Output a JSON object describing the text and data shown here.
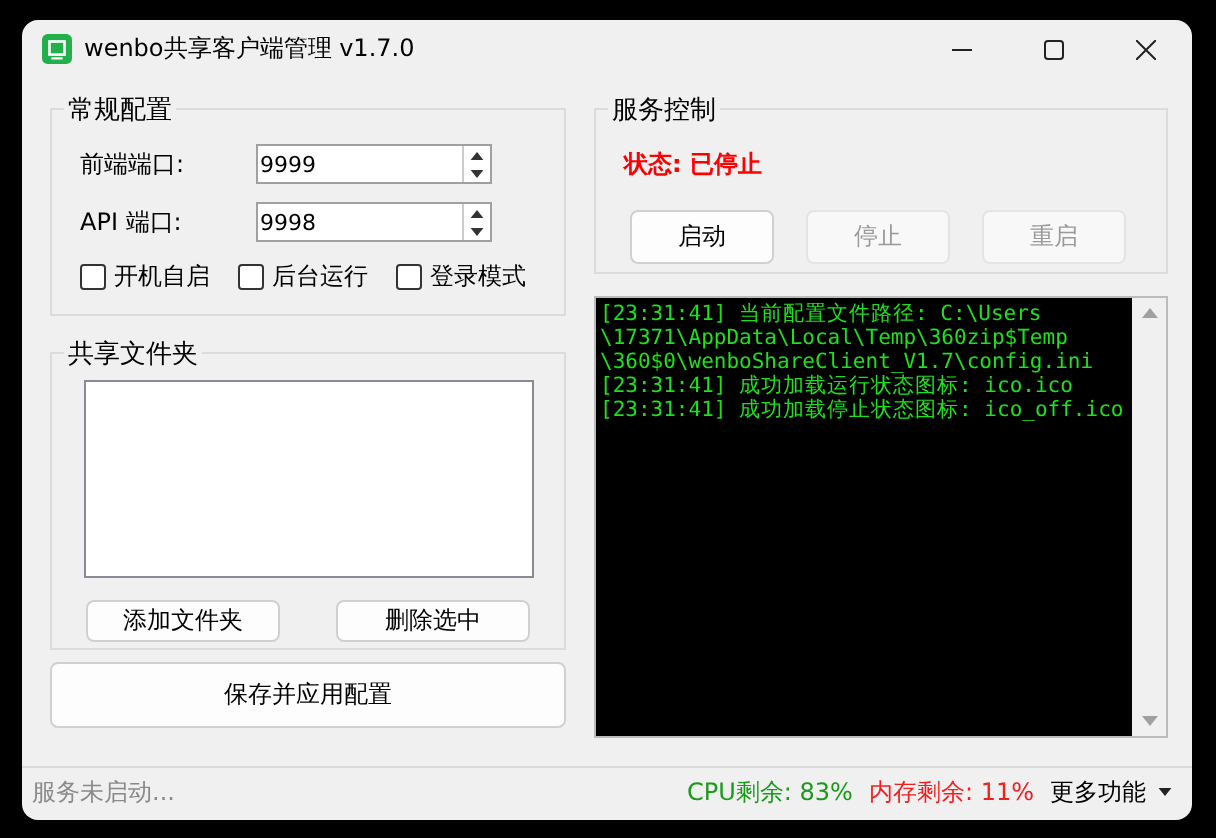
{
  "window": {
    "title": "wenbo共享客户端管理 v1.7.0"
  },
  "general": {
    "title": "常规配置",
    "ports": [
      {
        "label": "前端端口:",
        "value": "9999"
      },
      {
        "label": "API 端口:",
        "value": "9998"
      }
    ],
    "options": [
      {
        "label": "开机自启",
        "checked": false
      },
      {
        "label": "后台运行",
        "checked": false
      },
      {
        "label": "登录模式",
        "checked": false
      }
    ]
  },
  "shared": {
    "title": "共享文件夹",
    "buttons": [
      "添加文件夹",
      "删除选中"
    ]
  },
  "save_button": "保存并应用配置",
  "service": {
    "title": "服务控制",
    "status": "状态: 已停止",
    "running": false,
    "buttons": [
      {
        "label": "启动",
        "disabled": false
      },
      {
        "label": "停止",
        "disabled": true
      },
      {
        "label": "重启",
        "disabled": true
      }
    ]
  },
  "log": {
    "lines": [
      "[23:31:41] 当前配置文件路径: C:\\Users",
      "\\17371\\AppData\\Local\\Temp\\360zip$Temp",
      "\\360$0\\wenboShareClient_V1.7\\config.ini",
      "[23:31:41] 成功加载运行状态图标: ico.ico",
      "[23:31:41] 成功加载停止状态图标: ico_off.ico"
    ]
  },
  "status_bar": {
    "message": "服务未启动...",
    "meters": [
      {
        "text": "CPU剩余: 83%",
        "color": "#1a9a1a"
      },
      {
        "text": "内存剩余: 11%",
        "color": "#f02020"
      }
    ],
    "menu": "更多功能"
  }
}
